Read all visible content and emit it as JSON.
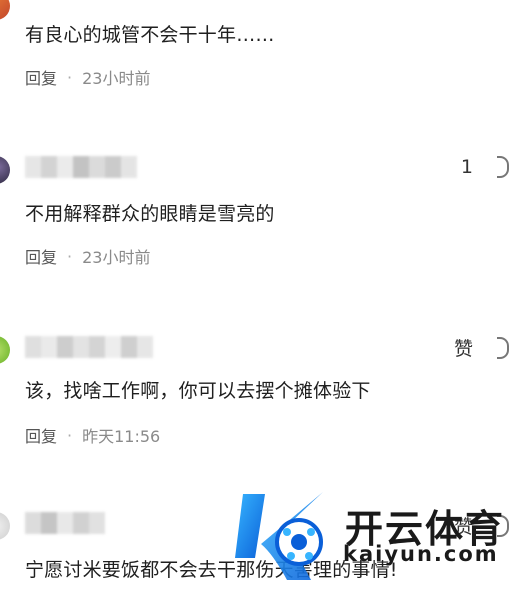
{
  "comments": [
    {
      "text": "有良心的城管不会干十年……",
      "reply_label": "回复",
      "time": "23小时前"
    },
    {
      "likes": "1",
      "text": "不用解释群众的眼睛是雪亮的",
      "reply_label": "回复",
      "time": "23小时前"
    },
    {
      "like_label": "赞",
      "text": "该，找啥工作啊，你可以去摆个摊体验下",
      "reply_label": "回复",
      "time": "昨天11:56"
    },
    {
      "like_label": "赞",
      "text": "宁愿讨米要饭都不会去干那伤天害理的事情!"
    }
  ],
  "separator": "·",
  "watermark": {
    "brand": "开云体育",
    "domain": "kaiyun.com"
  }
}
